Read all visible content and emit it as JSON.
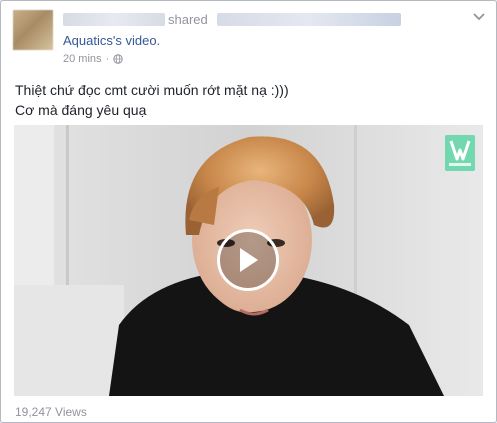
{
  "post": {
    "shared_word": "shared",
    "video_owner": "Aquatics",
    "video_suffix": "'s video.",
    "timestamp": "20 mins",
    "caption_line1": "Thiệt chứ đọc cmt cười muốn rớt mặt nạ :)))",
    "caption_line2": "Cơ mà đáng yêu quạ",
    "views": "19,247 Views"
  },
  "colors": {
    "link": "#365899",
    "meta": "#90949c",
    "text": "#1d2129",
    "vlive_green": "#5ed3a5"
  },
  "icons": {
    "privacy": "globe-icon",
    "menu": "chevron-down-icon",
    "play": "play-icon",
    "watermark": "vlive-logo"
  }
}
